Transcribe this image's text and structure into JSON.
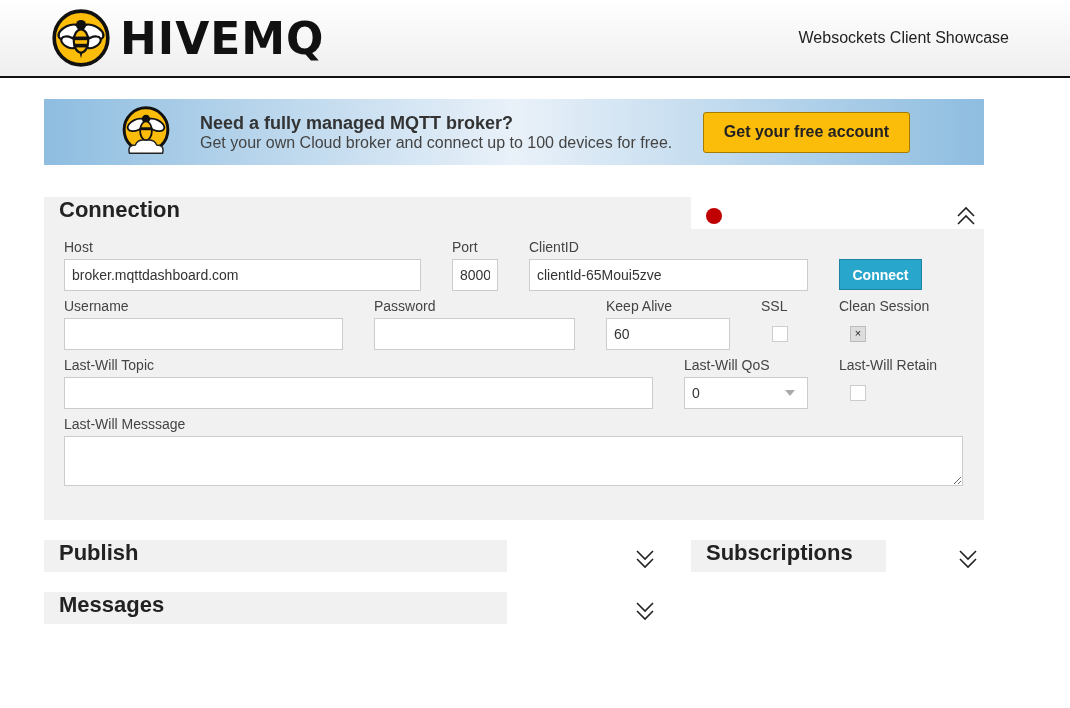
{
  "header": {
    "logo_text": "HIVEMQ",
    "subtitle": "Websockets Client Showcase"
  },
  "banner": {
    "title": "Need a fully managed MQTT broker?",
    "text": "Get your own Cloud broker and connect up to 100 devices for free.",
    "button": "Get your free account"
  },
  "connection": {
    "title": "Connection",
    "expanded": true,
    "status": {
      "color": "#c00000"
    },
    "host": {
      "label": "Host",
      "value": "broker.mqttdashboard.com"
    },
    "port": {
      "label": "Port",
      "value": "8000"
    },
    "client_id": {
      "label": "ClientID",
      "value": "clientId-65Moui5zve"
    },
    "connect_button": "Connect",
    "username": {
      "label": "Username"
    },
    "password": {
      "label": "Password"
    },
    "keep_alive": {
      "label": "Keep Alive",
      "value": "60"
    },
    "ssl": {
      "label": "SSL",
      "checked": false
    },
    "clean_session": {
      "label": "Clean Session",
      "checked": true,
      "mark": "×"
    },
    "lw_topic": {
      "label": "Last-Will Topic"
    },
    "lw_qos": {
      "label": "Last-Will QoS",
      "value": "0"
    },
    "lw_retain": {
      "label": "Last-Will Retain",
      "checked": false
    },
    "lw_message": {
      "label": "Last-Will Messsage"
    }
  },
  "publish": {
    "title": "Publish",
    "expanded": false
  },
  "subscriptions": {
    "title": "Subscriptions",
    "expanded": false
  },
  "messages": {
    "title": "Messages",
    "expanded": false
  }
}
